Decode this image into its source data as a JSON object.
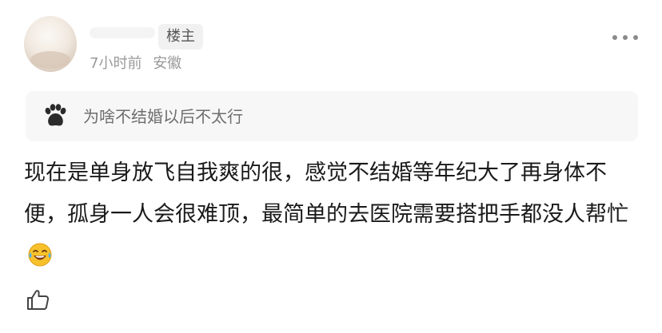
{
  "post": {
    "author_badge": "楼主",
    "time": "7小时前",
    "location": "安徽",
    "quote": {
      "icon": "paw-icon",
      "text": "为啥不结婚以后不太行"
    },
    "comment": {
      "text": "现在是单身放飞自我爽的很，感觉不结婚等年纪大了再身体不便，孤身一人会很难顶，最简单的去医院需要搭把手都没人帮忙",
      "emoji": "laughing-crying-emoji"
    },
    "actions": {
      "like_icon": "thumbs-up-icon",
      "more_icon": "more-dots-icon"
    }
  }
}
